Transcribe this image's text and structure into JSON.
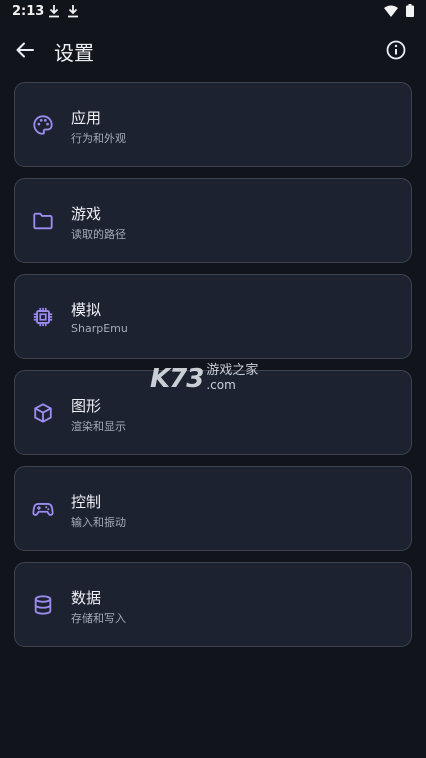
{
  "status": {
    "time": "2:13"
  },
  "header": {
    "title": "设置"
  },
  "items": [
    {
      "title": "应用",
      "subtitle": "行为和外观",
      "icon": "palette-icon"
    },
    {
      "title": "游戏",
      "subtitle": "读取的路径",
      "icon": "folder-icon"
    },
    {
      "title": "模拟",
      "subtitle": "SharpEmu",
      "icon": "chip-icon"
    },
    {
      "title": "图形",
      "subtitle": "渲染和显示",
      "icon": "cube-icon"
    },
    {
      "title": "控制",
      "subtitle": "输入和振动",
      "icon": "gamepad-icon"
    },
    {
      "title": "数据",
      "subtitle": "存储和写入",
      "icon": "database-icon"
    }
  ],
  "watermark": {
    "logo": "K73",
    "text": "游戏之家",
    "domain": ".com"
  },
  "colors": {
    "accent": "#9d8cf0",
    "background": "#11141b",
    "card": "#1d2230",
    "card_border": "#3d4350"
  }
}
